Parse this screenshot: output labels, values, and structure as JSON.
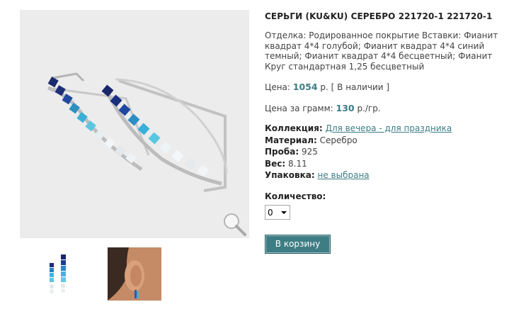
{
  "product": {
    "title": "СЕРЬГИ (KU&KU) СЕРЕБРО 221720-1 221720-1",
    "description": "Отделка: Родированное покрытие Вставки: Фианит квадрат 4*4 голубой; Фианит квадрат 4*4 синий темный; Фианит квадрат 4*4 бесцветный; Фианит Круг стандартная 1,25 бесцветный"
  },
  "price": {
    "label": "Цена:",
    "value": "1054",
    "suffix": "р. [ В наличии ]"
  },
  "gram_price": {
    "label": "Цена за грамм:",
    "value": "130",
    "suffix": "р./гр."
  },
  "props": {
    "collection_label": "Коллекция:",
    "collection_value": "Для вечера - для праздника",
    "material_label": "Материал:",
    "material_value": "Серебро",
    "proba_label": "Проба:",
    "proba_value": "925",
    "weight_label": "Вес:",
    "weight_value": "8.11",
    "packaging_label": "Упаковка:",
    "packaging_value": "не выбрана"
  },
  "quantity": {
    "label": "Количество:",
    "selected": "0"
  },
  "cart_button": "В корзину",
  "icons": [
    "zoom-magnifier-icon",
    "chevron-down-icon"
  ],
  "colors": {
    "accent": "#3c7d86",
    "button_bg": "#3f7d84",
    "image_bg": "#ececec"
  }
}
